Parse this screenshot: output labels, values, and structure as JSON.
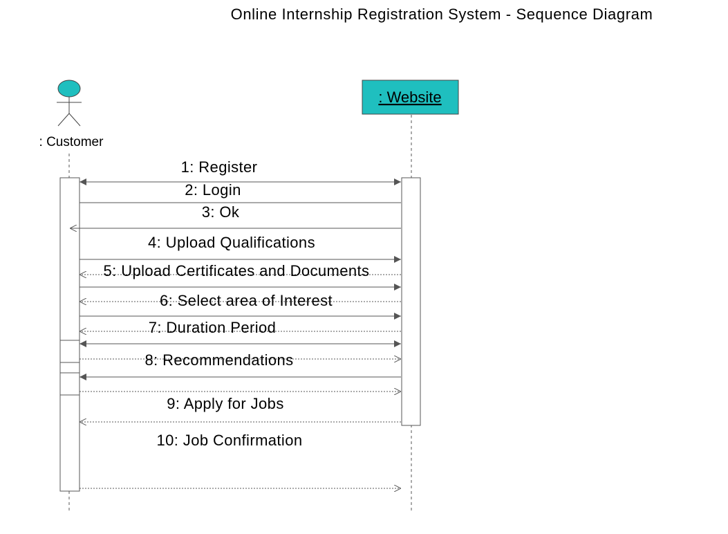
{
  "title": "Online Internship Registration System - Sequence Diagram",
  "colors": {
    "object_fill": "#1fbfbf",
    "line": "#555555",
    "text": "#111111"
  },
  "participants": {
    "customer": {
      "label": ": Customer",
      "kind": "actor"
    },
    "website": {
      "label": ": Website",
      "kind": "object"
    }
  },
  "messages": [
    {
      "label": "1: Register",
      "style": "solid",
      "head": "filled",
      "bidirectional": true
    },
    {
      "label": "2: Login",
      "style": "solid",
      "head": "none"
    },
    {
      "label": "3: Ok",
      "style": "solid",
      "head": "open"
    },
    {
      "label": "4: Upload Qualifications",
      "style": "solid",
      "head": "filled"
    },
    {
      "label": "5: Upload Certificates and Documents",
      "style": "dotted",
      "head": "open"
    },
    {
      "label": "6: Select area of Interest",
      "style": "dotted",
      "head": "open"
    },
    {
      "label": "7: Duration Period",
      "style": "dotted",
      "head": "open"
    },
    {
      "label": "8: Recommendations",
      "style": "dotted",
      "head": "open"
    },
    {
      "label": "9: Apply for Jobs",
      "style": "dotted",
      "head": "open"
    },
    {
      "label": "10: Job Confirmation",
      "style": "dotted",
      "head": "open"
    }
  ]
}
